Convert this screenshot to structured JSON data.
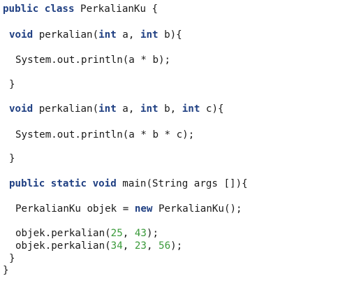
{
  "editor": {
    "language": "java",
    "colors": {
      "background": "#ffffff",
      "keyword": "#1f3f82",
      "number": "#3a9a3a",
      "text": "#1a1a1a"
    },
    "lines": [
      {
        "indent": "",
        "tokens": [
          {
            "t": "public",
            "k": "kw"
          },
          {
            "t": " ",
            "k": "plain"
          },
          {
            "t": "class",
            "k": "kw"
          },
          {
            "t": " PerkalianKu {",
            "k": "plain"
          }
        ]
      },
      {
        "indent": " ",
        "tokens": [
          {
            "t": "void",
            "k": "kw"
          },
          {
            "t": " perkalian(",
            "k": "plain"
          },
          {
            "t": "int",
            "k": "kw"
          },
          {
            "t": " a, ",
            "k": "plain"
          },
          {
            "t": "int",
            "k": "kw"
          },
          {
            "t": " b){",
            "k": "plain"
          }
        ]
      },
      {
        "indent": "  ",
        "tokens": [
          {
            "t": "System.out.println(a * b);",
            "k": "plain"
          }
        ]
      },
      {
        "indent": " ",
        "tokens": [
          {
            "t": "}",
            "k": "plain"
          }
        ]
      },
      {
        "indent": " ",
        "tokens": [
          {
            "t": "void",
            "k": "kw"
          },
          {
            "t": " perkalian(",
            "k": "plain"
          },
          {
            "t": "int",
            "k": "kw"
          },
          {
            "t": " a, ",
            "k": "plain"
          },
          {
            "t": "int",
            "k": "kw"
          },
          {
            "t": " b, ",
            "k": "plain"
          },
          {
            "t": "int",
            "k": "kw"
          },
          {
            "t": " c){",
            "k": "plain"
          }
        ]
      },
      {
        "indent": "  ",
        "tokens": [
          {
            "t": "System.out.println(a * b * c);",
            "k": "plain"
          }
        ]
      },
      {
        "indent": " ",
        "tokens": [
          {
            "t": "}",
            "k": "plain"
          }
        ]
      },
      {
        "indent": " ",
        "tokens": [
          {
            "t": "public",
            "k": "kw"
          },
          {
            "t": " ",
            "k": "plain"
          },
          {
            "t": "static",
            "k": "kw"
          },
          {
            "t": " ",
            "k": "plain"
          },
          {
            "t": "void",
            "k": "kw"
          },
          {
            "t": " main(String args []){",
            "k": "plain"
          }
        ]
      },
      {
        "indent": "  ",
        "tokens": [
          {
            "t": "PerkalianKu objek = ",
            "k": "plain"
          },
          {
            "t": "new",
            "k": "kw"
          },
          {
            "t": " PerkalianKu();",
            "k": "plain"
          }
        ]
      },
      {
        "indent": "  ",
        "tokens": [
          {
            "t": "objek.perkalian(",
            "k": "plain"
          },
          {
            "t": "25",
            "k": "num"
          },
          {
            "t": ", ",
            "k": "plain"
          },
          {
            "t": "43",
            "k": "num"
          },
          {
            "t": ");",
            "k": "plain"
          }
        ]
      },
      {
        "indent": "  ",
        "tokens": [
          {
            "t": "objek.perkalian(",
            "k": "plain"
          },
          {
            "t": "34",
            "k": "num"
          },
          {
            "t": ", ",
            "k": "plain"
          },
          {
            "t": "23",
            "k": "num"
          },
          {
            "t": ", ",
            "k": "plain"
          },
          {
            "t": "56",
            "k": "num"
          },
          {
            "t": ");",
            "k": "plain"
          }
        ]
      },
      {
        "indent": " ",
        "tokens": [
          {
            "t": "}",
            "k": "plain"
          }
        ]
      },
      {
        "indent": "",
        "tokens": [
          {
            "t": "}",
            "k": "plain"
          }
        ]
      }
    ]
  }
}
